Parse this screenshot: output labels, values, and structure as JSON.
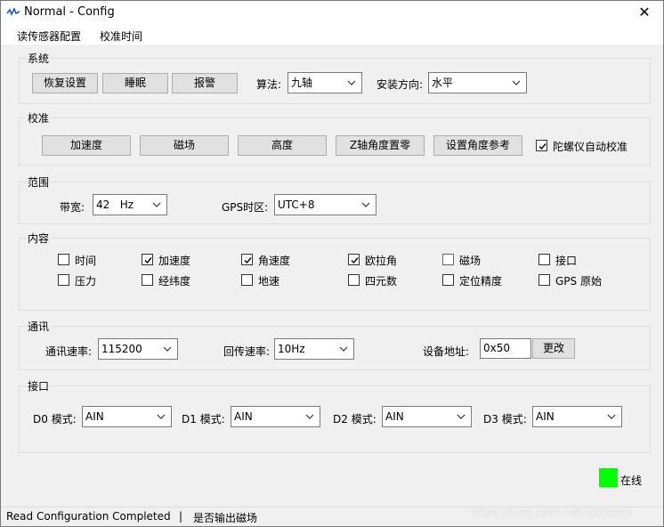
{
  "window": {
    "title": "Normal - Config",
    "close_glyph": "✕"
  },
  "menu": {
    "items": [
      "读传感器配置",
      "校准时间"
    ]
  },
  "system": {
    "title": "系统",
    "buttons": [
      "恢复设置",
      "睡眠",
      "报警"
    ],
    "algo_label": "算法:",
    "algo_value": "九轴",
    "mount_label": "安装方向:",
    "mount_value": "水平"
  },
  "calibration": {
    "title": "校准",
    "buttons": [
      "加速度",
      "磁场",
      "高度",
      "Z轴角度置零",
      "设置角度参考"
    ],
    "auto_gyro_label": "陀螺仪自动校准",
    "auto_gyro_checked": true
  },
  "range": {
    "title": "范围",
    "bandwidth_label": "带宽:",
    "bandwidth_value": "42   Hz",
    "gps_tz_label": "GPS时区:",
    "gps_tz_value": "UTC+8"
  },
  "content": {
    "title": "内容",
    "items": [
      {
        "label": "时间",
        "checked": false
      },
      {
        "label": "加速度",
        "checked": true
      },
      {
        "label": "角速度",
        "checked": true
      },
      {
        "label": "欧拉角",
        "checked": true
      },
      {
        "label": "磁场",
        "checked": false
      },
      {
        "label": "接口",
        "checked": false
      },
      {
        "label": "压力",
        "checked": false
      },
      {
        "label": "经纬度",
        "checked": false
      },
      {
        "label": "地速",
        "checked": false
      },
      {
        "label": "四元数",
        "checked": false
      },
      {
        "label": "定位精度",
        "checked": false
      },
      {
        "label": "GPS 原始",
        "checked": false
      }
    ]
  },
  "comm": {
    "title": "通讯",
    "baud_label": "通讯速率:",
    "baud_value": "115200",
    "rate_label": "回传速率:",
    "rate_value": "10Hz",
    "addr_label": "设备地址:",
    "addr_value": "0x50",
    "change_button": "更改"
  },
  "ports": {
    "title": "接口",
    "items": [
      {
        "label": "D0 模式:",
        "value": "AIN"
      },
      {
        "label": "D1 模式:",
        "value": "AIN"
      },
      {
        "label": "D2 模式:",
        "value": "AIN"
      },
      {
        "label": "D3 模式:",
        "value": "AIN"
      }
    ]
  },
  "online": {
    "label": "在线",
    "color": "#00ff00"
  },
  "status": {
    "message": "Read Configuration Completed",
    "separator": "|",
    "hint": "是否输出磁场",
    "watermark": "https://blog.csdn.net/lzzzzzzm"
  }
}
